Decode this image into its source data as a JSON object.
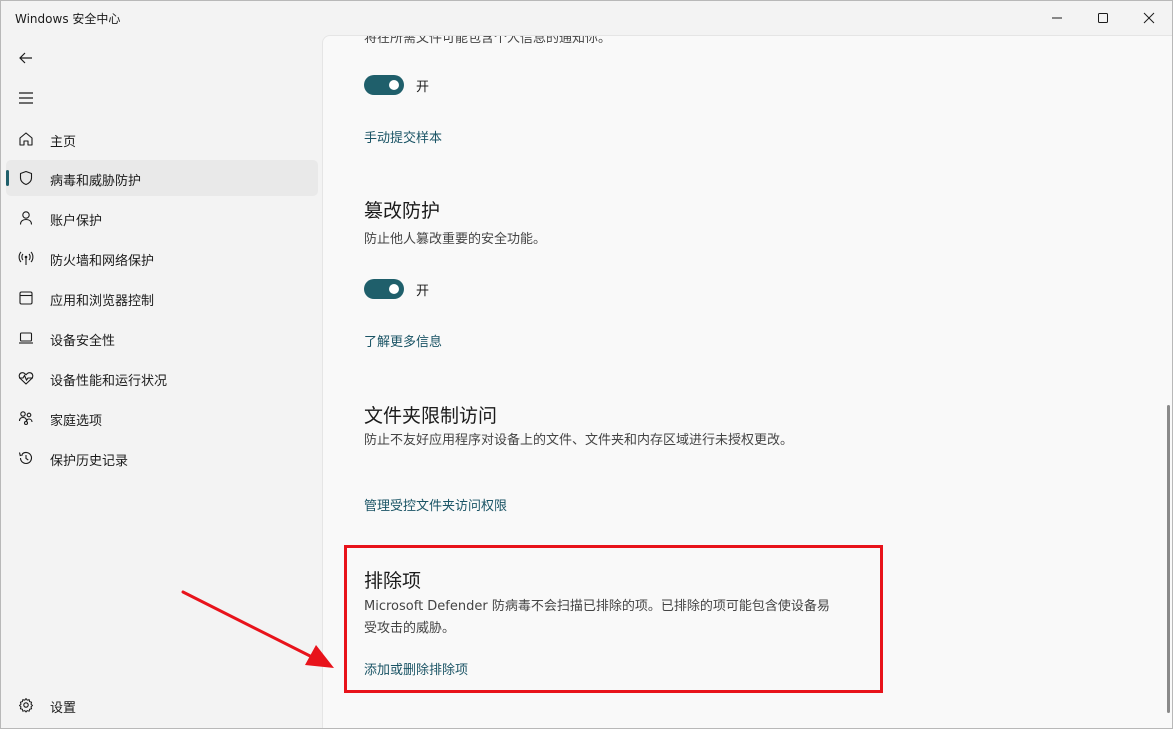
{
  "window": {
    "title": "Windows 安全中心"
  },
  "sidebar": {
    "items": [
      {
        "label": "主页",
        "icon": "home-icon"
      },
      {
        "label": "病毒和威胁防护",
        "icon": "shield-icon",
        "selected": true
      },
      {
        "label": "账户保护",
        "icon": "person-icon"
      },
      {
        "label": "防火墙和网络保护",
        "icon": "antenna-icon"
      },
      {
        "label": "应用和浏览器控制",
        "icon": "app-window-icon"
      },
      {
        "label": "设备安全性",
        "icon": "laptop-icon"
      },
      {
        "label": "设备性能和运行状况",
        "icon": "heart-pulse-icon"
      },
      {
        "label": "家庭选项",
        "icon": "family-icon"
      },
      {
        "label": "保护历史记录",
        "icon": "history-icon"
      }
    ],
    "settings_label": "设置"
  },
  "content": {
    "cut_text": "将在所需文件可能包含个人信息的通知你。",
    "auto_submit": {
      "toggle_label": "开",
      "link": "手动提交样本"
    },
    "tamper": {
      "title": "篡改防护",
      "desc": "防止他人篡改重要的安全功能。",
      "toggle_label": "开",
      "link": "了解更多信息"
    },
    "folder_access": {
      "title": "文件夹限制访问",
      "desc": "防止不友好应用程序对设备上的文件、文件夹和内存区域进行未授权更改。",
      "link": "管理受控文件夹访问权限"
    },
    "exclusions": {
      "title": "排除项",
      "desc": "Microsoft Defender 防病毒不会扫描已排除的项。已排除的项可能包含使设备易受攻击的威胁。",
      "link": "添加或删除排除项"
    }
  },
  "colors": {
    "accent": "#1f5f6b",
    "link": "#1a5465",
    "annotation": "#e8131b"
  }
}
